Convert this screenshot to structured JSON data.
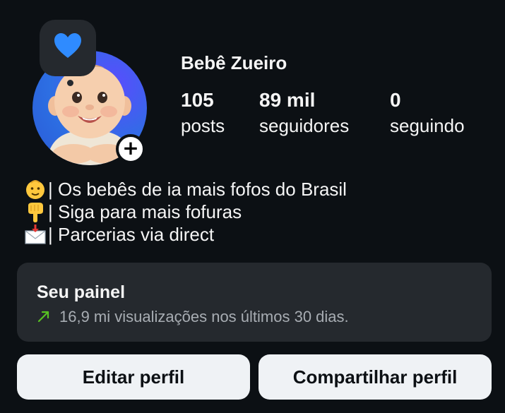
{
  "profile": {
    "username": "Bebê Zueiro",
    "note_icon": "blue-heart",
    "stats": {
      "posts": {
        "value": "105",
        "label": "posts"
      },
      "followers": {
        "value": "89 mil",
        "label": "seguidores"
      },
      "following": {
        "value": "0",
        "label": "seguindo"
      }
    }
  },
  "bio": {
    "lines": [
      {
        "icon": "baby-emoji-icon",
        "text": "| Os bebês de ia mais fofos do Brasil"
      },
      {
        "icon": "pointing-down-emoji-icon",
        "text": "| Siga para mais fofuras"
      },
      {
        "icon": "envelope-arrow-emoji-icon",
        "text": "| Parcerias via direct"
      }
    ]
  },
  "dashboard": {
    "title": "Seu painel",
    "subtitle": "16,9 mi visualizações nos últimos 30 dias.",
    "trend_color": "#58c322"
  },
  "actions": {
    "edit_label": "Editar perfil",
    "share_label": "Compartilhar perfil"
  },
  "colors": {
    "background": "#0c1014",
    "card": "#25292e",
    "button": "#eff2f5",
    "heart": "#2f8bff"
  }
}
